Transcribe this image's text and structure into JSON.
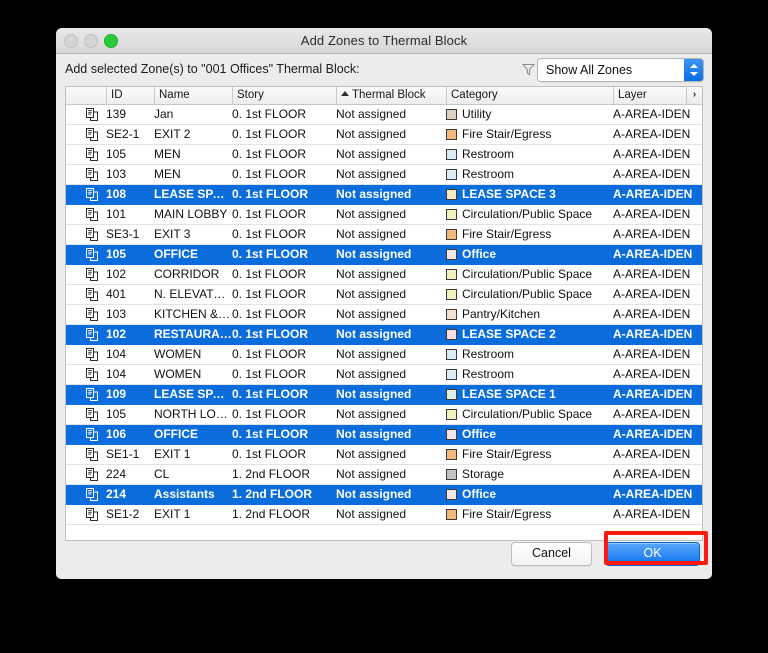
{
  "window": {
    "title": "Add Zones to Thermal Block",
    "traffic_lights": [
      "close",
      "minimize",
      "zoom"
    ]
  },
  "prompt": {
    "label": "Add selected Zone(s) to \"001 Offices\" Thermal Block:",
    "filter_icon": "funnel-filter-icon",
    "filter_select": {
      "value": "Show All Zones",
      "options": [
        "Show All Zones"
      ]
    }
  },
  "table": {
    "columns": [
      {
        "key": "icon",
        "label": ""
      },
      {
        "key": "id",
        "label": "ID"
      },
      {
        "key": "name",
        "label": "Name"
      },
      {
        "key": "story",
        "label": "Story"
      },
      {
        "key": "tb",
        "label": "Thermal Block",
        "sorted": "asc"
      },
      {
        "key": "cat",
        "label": "Category"
      },
      {
        "key": "layer",
        "label": "Layer"
      }
    ],
    "expander_label": "›",
    "rows": [
      {
        "id": "139",
        "name": "Jan",
        "story": "0. 1st FLOOR",
        "tb": "Not assigned",
        "cat": "Utility",
        "swatch": "#ddd0c3",
        "layer": "A-AREA-IDEN",
        "selected": false
      },
      {
        "id": "SE2-1",
        "name": "EXIT 2",
        "story": "0. 1st FLOOR",
        "tb": "Not assigned",
        "cat": "Fire Stair/Egress",
        "swatch": "#f5b878",
        "layer": "A-AREA-IDEN",
        "selected": false
      },
      {
        "id": "105",
        "name": "MEN",
        "story": "0. 1st FLOOR",
        "tb": "Not assigned",
        "cat": "Restroom",
        "swatch": "#dcecf6",
        "layer": "A-AREA-IDEN",
        "selected": false
      },
      {
        "id": "103",
        "name": "MEN",
        "story": "0. 1st FLOOR",
        "tb": "Not assigned",
        "cat": "Restroom",
        "swatch": "#dcecf6",
        "layer": "A-AREA-IDEN",
        "selected": false
      },
      {
        "id": "108",
        "name": "LEASE SPACE",
        "story": "0. 1st FLOOR",
        "tb": "Not assigned",
        "cat": "LEASE SPACE 3",
        "swatch": "#f6ecc2",
        "layer": "A-AREA-IDEN",
        "selected": true
      },
      {
        "id": "101",
        "name": "MAIN LOBBY",
        "story": "0. 1st FLOOR",
        "tb": "Not assigned",
        "cat": "Circulation/Public Space",
        "swatch": "#f3f0bd",
        "layer": "A-AREA-IDEN",
        "selected": false
      },
      {
        "id": "SE3-1",
        "name": "EXIT 3",
        "story": "0. 1st FLOOR",
        "tb": "Not assigned",
        "cat": "Fire Stair/Egress",
        "swatch": "#f5b878",
        "layer": "A-AREA-IDEN",
        "selected": false
      },
      {
        "id": "105",
        "name": "OFFICE",
        "story": "0. 1st FLOOR",
        "tb": "Not assigned",
        "cat": "Office",
        "swatch": "#f8e3ea",
        "layer": "A-AREA-IDEN",
        "selected": true
      },
      {
        "id": "102",
        "name": "CORRIDOR",
        "story": "0. 1st FLOOR",
        "tb": "Not assigned",
        "cat": "Circulation/Public Space",
        "swatch": "#f3f0bd",
        "layer": "A-AREA-IDEN",
        "selected": false
      },
      {
        "id": "401",
        "name": "N. ELEVATO…",
        "story": "0. 1st FLOOR",
        "tb": "Not assigned",
        "cat": "Circulation/Public Space",
        "swatch": "#f3f0bd",
        "layer": "A-AREA-IDEN",
        "selected": false
      },
      {
        "id": "103",
        "name": "KITCHEN &…",
        "story": "0. 1st FLOOR",
        "tb": "Not assigned",
        "cat": "Pantry/Kitchen",
        "swatch": "#f7e2d2",
        "layer": "A-AREA-IDEN",
        "selected": false
      },
      {
        "id": "102",
        "name": "RESTAURAN…",
        "story": "0. 1st FLOOR",
        "tb": "Not assigned",
        "cat": "LEASE SPACE 2",
        "swatch": "#f8dde3",
        "layer": "A-AREA-IDEN",
        "selected": true
      },
      {
        "id": "104",
        "name": "WOMEN",
        "story": "0. 1st FLOOR",
        "tb": "Not assigned",
        "cat": "Restroom",
        "swatch": "#dcecf6",
        "layer": "A-AREA-IDEN",
        "selected": false
      },
      {
        "id": "104",
        "name": "WOMEN",
        "story": "0. 1st FLOOR",
        "tb": "Not assigned",
        "cat": "Restroom",
        "swatch": "#dcecf6",
        "layer": "A-AREA-IDEN",
        "selected": false
      },
      {
        "id": "109",
        "name": "LEASE SPACE",
        "story": "0. 1st FLOOR",
        "tb": "Not assigned",
        "cat": "LEASE SPACE 1",
        "swatch": "#dff2e0",
        "layer": "A-AREA-IDEN",
        "selected": true
      },
      {
        "id": "105",
        "name": "NORTH LOB…",
        "story": "0. 1st FLOOR",
        "tb": "Not assigned",
        "cat": "Circulation/Public Space",
        "swatch": "#f3f0bd",
        "layer": "A-AREA-IDEN",
        "selected": false
      },
      {
        "id": "106",
        "name": "OFFICE",
        "story": "0. 1st FLOOR",
        "tb": "Not assigned",
        "cat": "Office",
        "swatch": "#f8e3ea",
        "layer": "A-AREA-IDEN",
        "selected": true
      },
      {
        "id": "SE1-1",
        "name": "EXIT 1",
        "story": "0. 1st FLOOR",
        "tb": "Not assigned",
        "cat": "Fire Stair/Egress",
        "swatch": "#f5b878",
        "layer": "A-AREA-IDEN",
        "selected": false
      },
      {
        "id": "224",
        "name": "CL",
        "story": "1. 2nd FLOOR",
        "tb": "Not assigned",
        "cat": "Storage",
        "swatch": "#c4c4c4",
        "layer": "A-AREA-IDEN",
        "selected": false
      },
      {
        "id": "214",
        "name": "Assistants",
        "story": "1. 2nd FLOOR",
        "tb": "Not assigned",
        "cat": "Office",
        "swatch": "#f8e3ea",
        "layer": "A-AREA-IDEN",
        "selected": true
      },
      {
        "id": "SE1-2",
        "name": "EXIT 1",
        "story": "1. 2nd FLOOR",
        "tb": "Not assigned",
        "cat": "Fire Stair/Egress",
        "swatch": "#f5b878",
        "layer": "A-AREA-IDEN",
        "selected": false
      }
    ]
  },
  "footer": {
    "cancel_label": "Cancel",
    "ok_label": "OK"
  },
  "annotation": {
    "highlight_color": "#ff1c0f",
    "highlight_target": "ok-button"
  },
  "colors": {
    "selection_blue": "#0b6ddb",
    "accent_blue": "#1072ef",
    "window_bg": "#ececec"
  }
}
